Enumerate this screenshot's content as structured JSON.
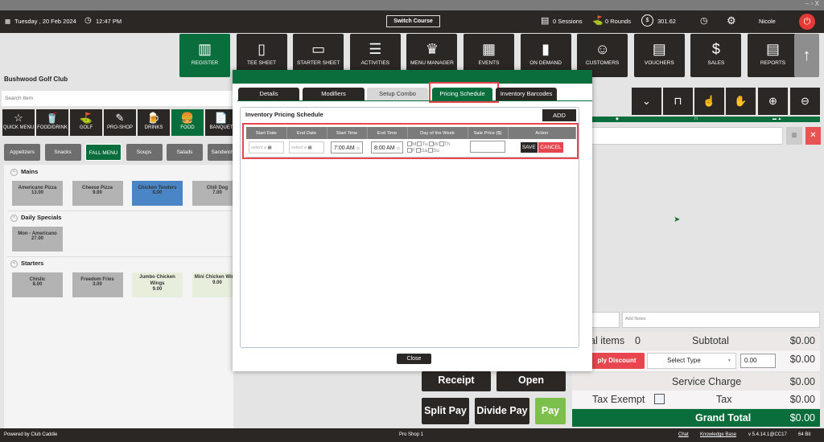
{
  "window": {
    "controls": "– ▫ X"
  },
  "topbar": {
    "date": "Tuesday , 20 Feb 2024",
    "time": "12:47 PM",
    "switch_course": "Switch Course",
    "sessions": "0 Sessions",
    "rounds": "0 Rounds",
    "balance": "301.62",
    "user": "Nicole"
  },
  "nav": [
    {
      "label": "REGISTER",
      "icon": "register-scanner-icon"
    },
    {
      "label": "TEE SHEET",
      "icon": "tee-sheet-icon"
    },
    {
      "label": "STARTER SHEET",
      "icon": "tablet-icon"
    },
    {
      "label": "ACTIVITIES",
      "icon": "calendar-icon"
    },
    {
      "label": "MENU MANAGER",
      "icon": "menu-manager-icon"
    },
    {
      "label": "EVENTS",
      "icon": "events-icon"
    },
    {
      "label": "ON DEMAND",
      "icon": "phone-icon"
    },
    {
      "label": "CUSTOMERS",
      "icon": "customers-icon"
    },
    {
      "label": "VOUCHERS",
      "icon": "vouchers-icon"
    },
    {
      "label": "SALES",
      "icon": "sales-icon"
    },
    {
      "label": "REPORTS",
      "icon": "reports-icon"
    }
  ],
  "club_name": "Bushwood Golf Club",
  "search": {
    "placeholder": "Search Item"
  },
  "categories": [
    {
      "label": "QUICK MENU",
      "icon": "☆"
    },
    {
      "label": "FOOD/DRINK",
      "icon": "🥤"
    },
    {
      "label": "GOLF",
      "icon": "⛳"
    },
    {
      "label": "PRO-SHOP",
      "icon": "✎"
    },
    {
      "label": "DRINKS",
      "icon": "🍺"
    },
    {
      "label": "FOOD",
      "icon": "🍔"
    },
    {
      "label": "BANQUET",
      "icon": "📄"
    }
  ],
  "subcategories": [
    "Appetizers",
    "Snacks",
    "FALL MENU",
    "Soups",
    "Salads",
    "Sandwiches"
  ],
  "sections": [
    {
      "title": "Mains",
      "items": [
        {
          "name": "Americano Pizza",
          "price": "13.00"
        },
        {
          "name": "Cheese Pizza",
          "price": "9.00"
        },
        {
          "name": "Chicken Tenders",
          "price": "8.00"
        },
        {
          "name": "Chili Dog",
          "price": "7.00"
        }
      ]
    },
    {
      "title": "Daily Specials",
      "items": [
        {
          "name": "Mon - Americano",
          "price": "27.00"
        }
      ]
    },
    {
      "title": "Starters",
      "items": [
        {
          "name": "Chislic",
          "price": "8.00"
        },
        {
          "name": "Freedom Fries",
          "price": "3.00"
        },
        {
          "name": "Jumbo Chicken Wings",
          "price": "9.00"
        },
        {
          "name": "Mini Chicken Wings",
          "price": "9.00"
        }
      ]
    }
  ],
  "modal": {
    "tabs": [
      "Details",
      "Modifiers",
      "Setup Combo",
      "Pricing Schedule",
      "Inventory Barcodes"
    ],
    "active_tab": "Pricing Schedule",
    "title": "Inventory Pricing Schedule",
    "add": "ADD",
    "columns": [
      "Start Date",
      "End Date",
      "Start Time",
      "End Time",
      "Day of the Week",
      "Sale Price ($)",
      "Action"
    ],
    "row": {
      "start_date_placeholder": "select a",
      "end_date_placeholder": "select a",
      "start_time": "7:00 AM",
      "end_time": "8:00 AM",
      "days": [
        "M",
        "Tu",
        "W",
        "Th",
        "F",
        "Sa",
        "Su"
      ],
      "sale_price": "",
      "save": "SAVE",
      "cancel": "CANCEL"
    },
    "close": "Close"
  },
  "order": {
    "notes_placeholder": "Add Notes",
    "total_items_label": "al items",
    "total_items": "0",
    "subtotal_label": "Subtotal",
    "subtotal": "$0.00",
    "discount_btn": "ply Discount",
    "discount_type": "Select Type",
    "discount_value": "0.00",
    "discount_amount": "$0.00",
    "service_label": "Service Charge",
    "service": "$0.00",
    "tax_exempt": "Tax Exempt",
    "tax_label": "Tax",
    "tax": "$0.00",
    "grand_label": "Grand Total",
    "grand": "$0.00"
  },
  "actions": {
    "receipt": "Receipt",
    "open": "Open",
    "split": "Split Pay",
    "divide": "Divide Pay",
    "pay": "Pay"
  },
  "footer": {
    "powered": "Powered by Club Caddie",
    "station": "Pro Shop 1",
    "chat": "Chat",
    "kb": "Knowledge Base",
    "version": "v 5.4.14.1@CC17",
    "bit": "64 Bit"
  },
  "colors": {
    "brand_green": "#0a6e3c",
    "dark": "#2b2725",
    "danger": "#e8454f",
    "pay_green": "#7cc04b",
    "selected_item": "#4a86c5"
  }
}
